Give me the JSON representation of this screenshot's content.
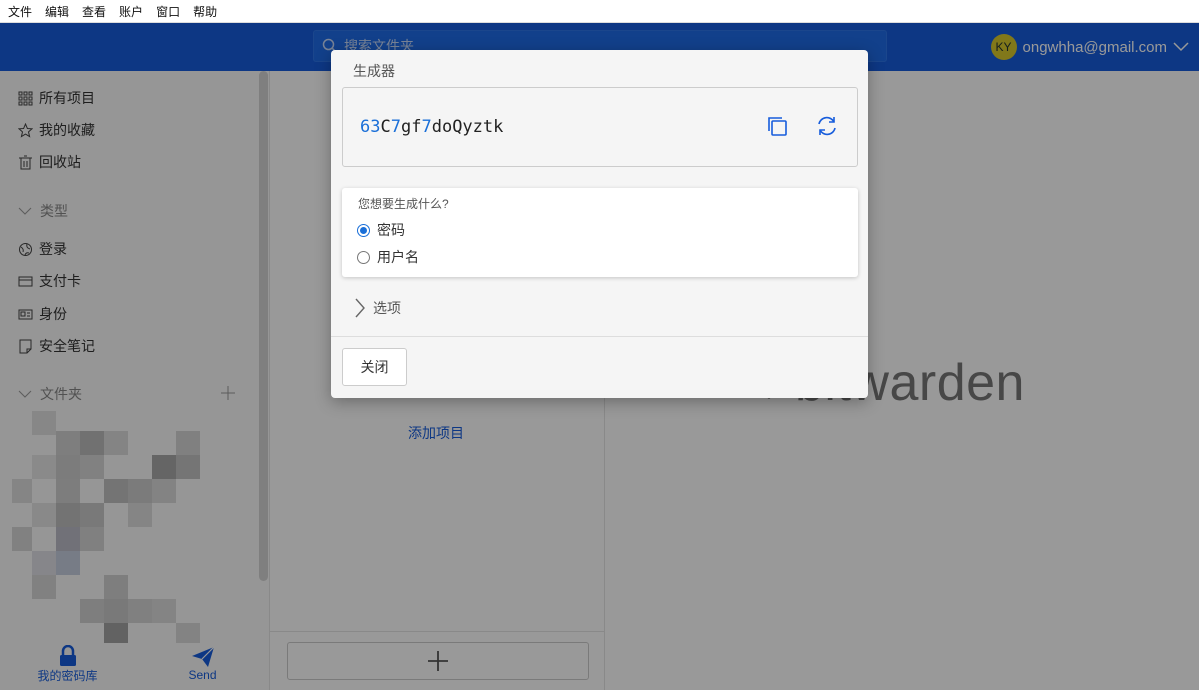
{
  "menu": [
    "文件",
    "编辑",
    "查看",
    "账户",
    "窗口",
    "帮助"
  ],
  "header": {
    "search_placeholder": "搜索文件夹",
    "avatar_initials": "KY",
    "account_email": "ongwhha@gmail.com"
  },
  "sidebar": {
    "items": [
      {
        "label": "所有项目",
        "icon": "grid-icon"
      },
      {
        "label": "我的收藏",
        "icon": "star-icon"
      },
      {
        "label": "回收站",
        "icon": "trash-icon"
      }
    ],
    "types_header": "类型",
    "types": [
      {
        "label": "登录",
        "icon": "globe-icon"
      },
      {
        "label": "支付卡",
        "icon": "credit-card-icon"
      },
      {
        "label": "身份",
        "icon": "id-card-icon"
      },
      {
        "label": "安全笔记",
        "icon": "note-icon"
      }
    ],
    "folders_header": "文件夹",
    "bottom": {
      "vault_label": "我的密码库",
      "send_label": "Send"
    }
  },
  "list": {
    "add_item_link": "添加项目"
  },
  "brand": {
    "logo_text": "bitwarden"
  },
  "generator": {
    "title": "生成器",
    "password_parts": [
      {
        "t": "63",
        "num": true
      },
      {
        "t": "C",
        "num": false
      },
      {
        "t": "7",
        "num": true
      },
      {
        "t": "gf",
        "num": false
      },
      {
        "t": "7",
        "num": true
      },
      {
        "t": "doQyztk",
        "num": false
      }
    ],
    "question": "您想要生成什么?",
    "options": [
      {
        "label": "密码",
        "checked": true
      },
      {
        "label": "用户名",
        "checked": false
      }
    ],
    "options_toggle": "选项",
    "close_label": "关闭"
  },
  "colors": {
    "brand": "#175ddc",
    "accent": "#1a6fd8"
  }
}
